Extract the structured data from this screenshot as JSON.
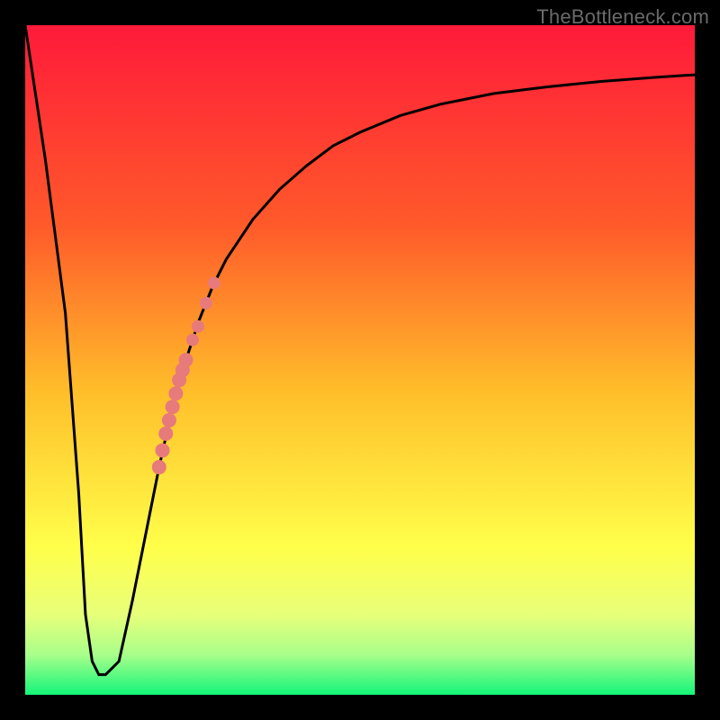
{
  "watermark": "TheBottleneck.com",
  "chart_data": {
    "type": "line",
    "title": "",
    "xlabel": "",
    "ylabel": "",
    "x_range": [
      0,
      100
    ],
    "y_range": [
      0,
      100
    ],
    "background_gradient": {
      "type": "vertical",
      "stops": [
        {
          "pos": 0.0,
          "color": "#ff1a3a"
        },
        {
          "pos": 0.3,
          "color": "#ff5a2a"
        },
        {
          "pos": 0.55,
          "color": "#ffbf2a"
        },
        {
          "pos": 0.78,
          "color": "#ffff4a"
        },
        {
          "pos": 0.88,
          "color": "#e8ff7a"
        },
        {
          "pos": 0.94,
          "color": "#a8ff8a"
        },
        {
          "pos": 1.0,
          "color": "#14f57a"
        }
      ]
    },
    "series": [
      {
        "name": "bottleneck-curve",
        "color": "#000000",
        "type": "line",
        "x": [
          0,
          3,
          6,
          8,
          9,
          10,
          11,
          12,
          14,
          16,
          18,
          20,
          22,
          24,
          26,
          28,
          30,
          34,
          38,
          42,
          46,
          50,
          56,
          62,
          70,
          78,
          86,
          94,
          100
        ],
        "y": [
          100,
          80,
          57,
          30,
          12,
          5,
          3,
          3,
          5,
          14,
          24,
          34,
          43,
          50,
          56,
          61,
          65,
          71,
          75.5,
          79,
          82,
          84,
          86.5,
          88.2,
          89.8,
          90.8,
          91.6,
          92.2,
          92.6
        ]
      },
      {
        "name": "highlight-dots",
        "color": "#e77a7a",
        "type": "scatter",
        "x": [
          20.0,
          20.5,
          21.0,
          21.5,
          22.0,
          22.5,
          23.0,
          23.5,
          24.0,
          25.0,
          25.8,
          27.0,
          28.2
        ],
        "y": [
          34.0,
          36.5,
          39.0,
          41.0,
          43.0,
          45.0,
          47.0,
          48.5,
          50.0,
          53.0,
          55.0,
          58.5,
          61.5
        ]
      }
    ]
  }
}
